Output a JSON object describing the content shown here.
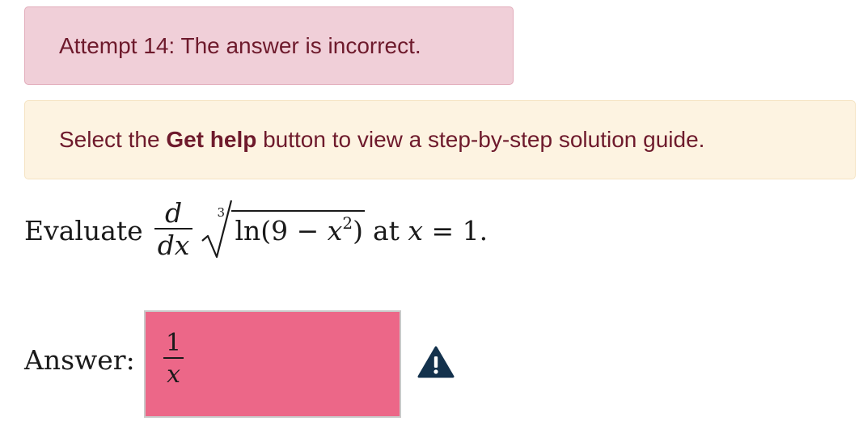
{
  "feedback": {
    "error_text": "Attempt 14: The answer is incorrect.",
    "help_prefix": "Select the ",
    "help_bold": "Get help",
    "help_suffix": " button to view a step-by-step solution guide."
  },
  "question": {
    "lead": "Evaluate",
    "deriv_num": "d",
    "deriv_den": "dx",
    "root_index": "3",
    "radicand_prefix": "ln(9 − ",
    "radicand_var": "x",
    "radicand_exp": "2",
    "radicand_suffix": ")",
    "at_text": "at ",
    "at_var": "x",
    "at_value": " = 1."
  },
  "answer": {
    "label": "Answer:",
    "numerator": "1",
    "denominator": "x",
    "status": "incorrect",
    "box_color": "#ec6788"
  },
  "icons": {
    "status_icon": "warning-icon",
    "warning_color": "#14324d"
  }
}
